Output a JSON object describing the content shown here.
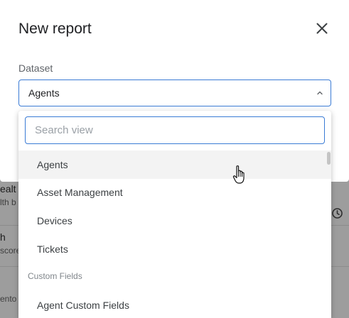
{
  "background": {
    "rows": [
      {
        "title": "ealt",
        "subtitle": "lth b"
      },
      {
        "title": "h",
        "subtitle": "score"
      },
      {
        "title": "ento",
        "subtitle": ""
      }
    ]
  },
  "modal": {
    "title": "New report",
    "dataset_label": "Dataset",
    "dataset_value": "Agents"
  },
  "dropdown": {
    "search_placeholder": "Search view",
    "options": [
      {
        "label": "Agents"
      },
      {
        "label": "Asset Management"
      },
      {
        "label": "Devices"
      },
      {
        "label": "Tickets"
      }
    ],
    "group_label": "Custom Fields",
    "group_options": [
      {
        "label": "Agent Custom Fields"
      }
    ]
  },
  "icons": {
    "close": "close-icon",
    "chevron": "chevron-up-icon",
    "clock": "clock-icon",
    "cursor": "hand-pointer-icon"
  },
  "colors": {
    "accent": "#3a7bd5",
    "hover_bg": "#f3f3f3"
  }
}
